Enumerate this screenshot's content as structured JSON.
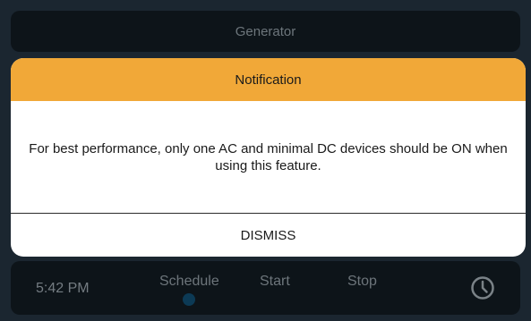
{
  "header": {
    "title": "Generator"
  },
  "notification": {
    "title": "Notification",
    "message": "For best performance, only one AC and minimal DC devices should be ON when using this feature.",
    "dismiss_label": "DISMISS",
    "header_color": "#f1a838"
  },
  "bottom_bar": {
    "time": "5:42 PM",
    "schedule_label": "Schedule",
    "start_label": "Start",
    "stop_label": "Stop",
    "clock_icon": "clock-icon"
  }
}
